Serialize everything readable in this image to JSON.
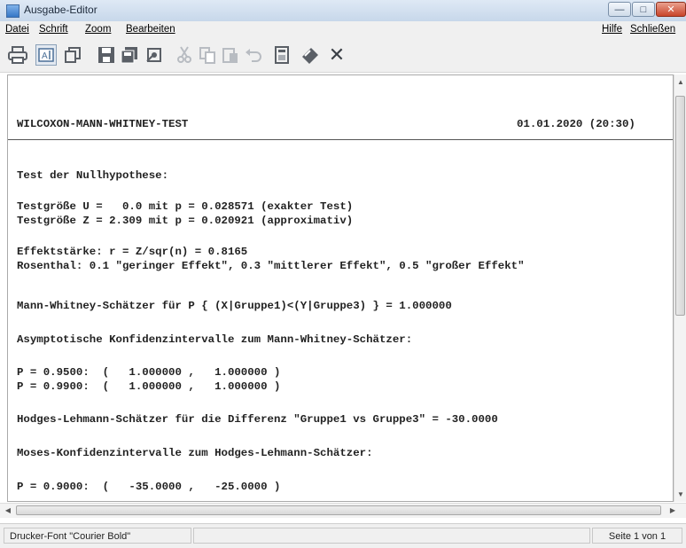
{
  "window": {
    "title": "Ausgabe-Editor"
  },
  "menu": {
    "datei": "Datei",
    "schrift": "Schrift",
    "zoom": "Zoom",
    "bearbeiten": "Bearbeiten",
    "hilfe": "Hilfe",
    "schliessen": "Schließen"
  },
  "toolbar": {
    "icons": [
      "printer-icon",
      "text-select-icon",
      "copy-window-icon",
      "save-icon",
      "save-as-icon",
      "settings-icon",
      "cut-icon",
      "copy-icon",
      "paste-icon",
      "undo-icon",
      "calculator-icon",
      "edit-icon",
      "close-icon"
    ]
  },
  "doc": {
    "header_title": "WILCOXON-MANN-WHITNEY-TEST",
    "header_date": "01.01.2020 (20:30)",
    "lines": [
      "Test der Nullhypothese:",
      "Testgröße U =   0.0 mit p = 0.028571 (exakter Test)",
      "Testgröße Z = 2.309 mit p = 0.020921 (approximativ)",
      "Effektstärke: r = Z/sqr(n) = 0.8165",
      "Rosenthal: 0.1 \"geringer Effekt\", 0.3 \"mittlerer Effekt\", 0.5 \"großer Effekt\"",
      "Mann-Whitney-Schätzer für P { (X|Gruppe1)<(Y|Gruppe3) } = 1.000000",
      "Asymptotische Konfidenzintervalle zum Mann-Whitney-Schätzer:",
      "P = 0.9500:  (   1.000000 ,   1.000000 )",
      "P = 0.9900:  (   1.000000 ,   1.000000 )",
      "Hodges-Lehmann-Schätzer für die Differenz \"Gruppe1 vs Gruppe3\" = -30.0000",
      "Moses-Konfidenzintervalle zum Hodges-Lehmann-Schätzer:",
      "P = 0.9000:  (   -35.0000 ,   -25.0000 )"
    ]
  },
  "status": {
    "font": "Drucker-Font \"Courier Bold\"",
    "page": "Seite 1 von 1"
  }
}
